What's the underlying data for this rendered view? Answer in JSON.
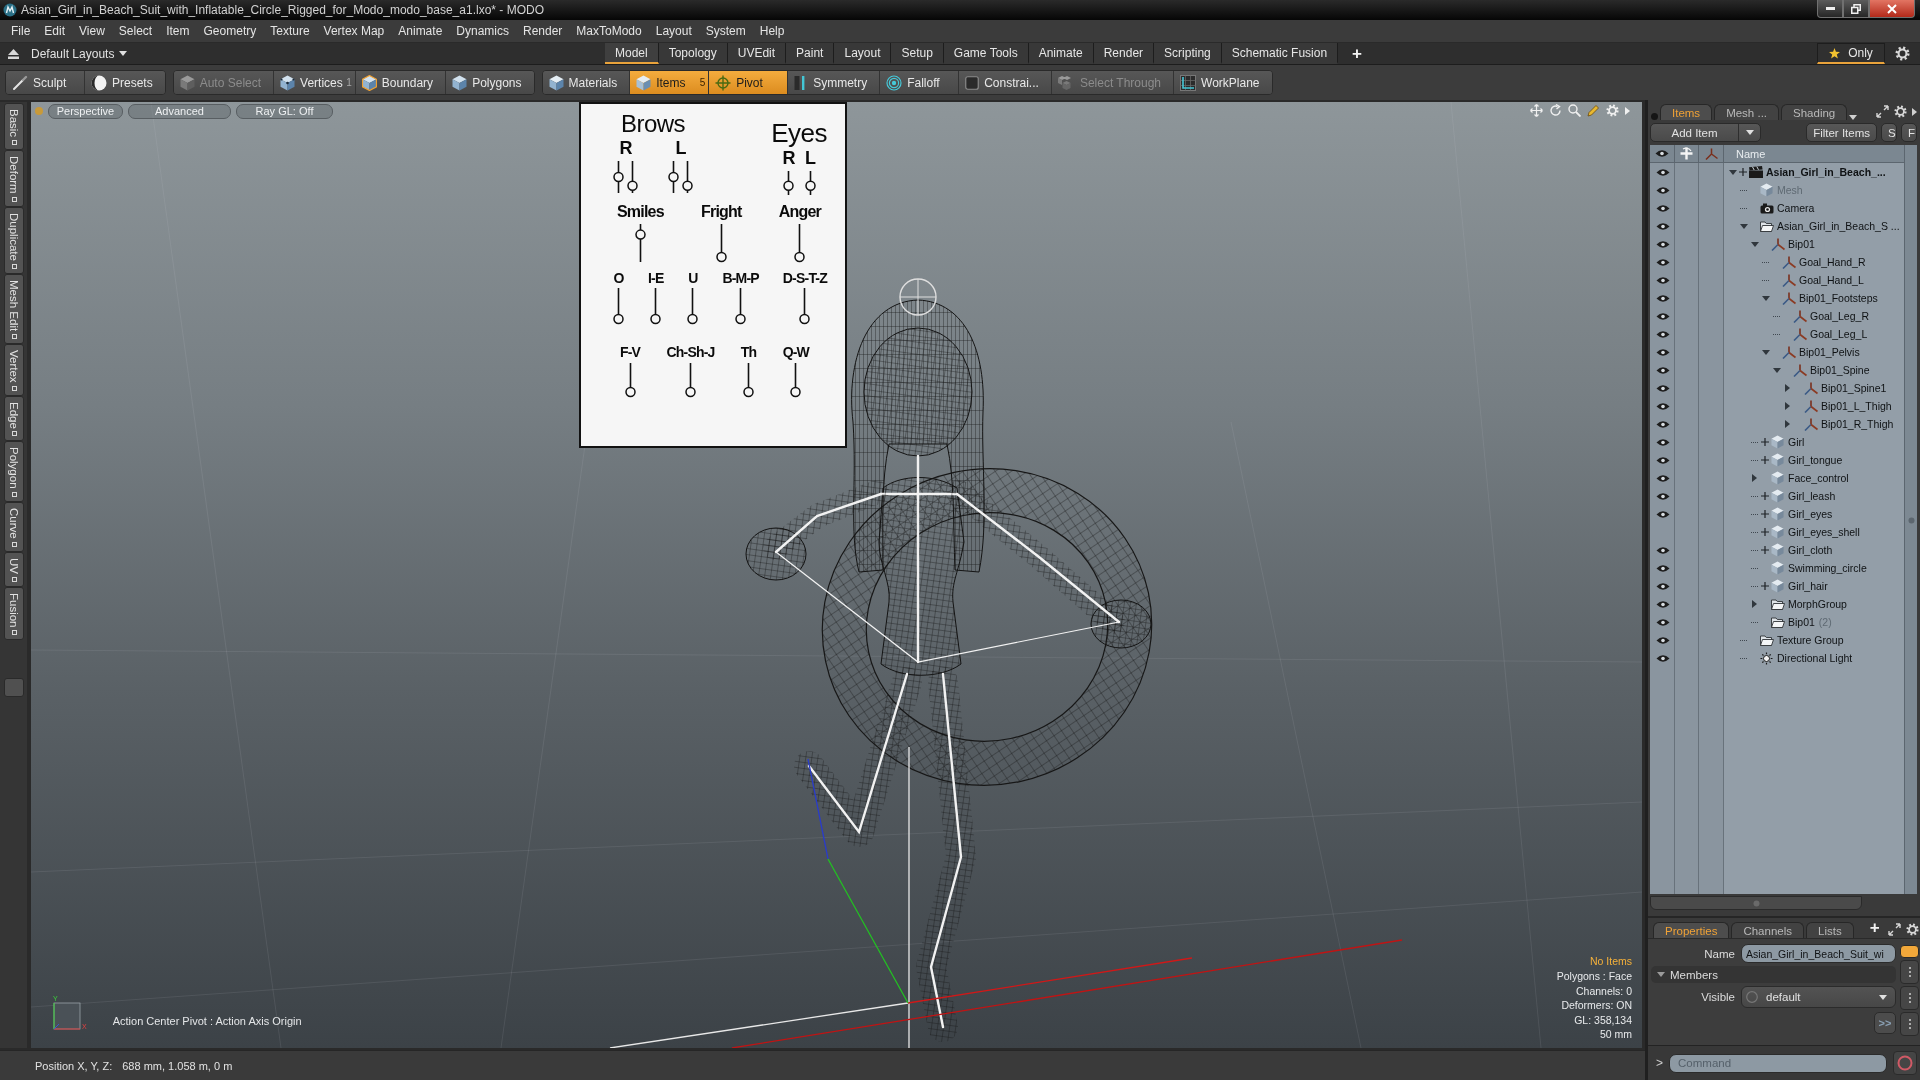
{
  "window": {
    "title": "Asian_Girl_in_Beach_Suit_with_Inflatable_Circle_Rigged_for_Modo_modo_base_a1.lxo* - MODO"
  },
  "menu": [
    "File",
    "Edit",
    "View",
    "Select",
    "Item",
    "Geometry",
    "Texture",
    "Vertex Map",
    "Animate",
    "Dynamics",
    "Render",
    "MaxToModo",
    "Layout",
    "System",
    "Help"
  ],
  "layout_bar": {
    "layouts": "Default Layouts",
    "tabs": [
      {
        "label": "Model",
        "selected": true
      },
      {
        "label": "Topology",
        "selected": false
      },
      {
        "label": "UVEdit",
        "selected": false
      },
      {
        "label": "Paint",
        "selected": false
      },
      {
        "label": "Layout",
        "selected": false
      },
      {
        "label": "Setup",
        "selected": false
      },
      {
        "label": "Game Tools",
        "selected": false
      },
      {
        "label": "Animate",
        "selected": false
      },
      {
        "label": "Render",
        "selected": false
      },
      {
        "label": "Scripting",
        "selected": false
      },
      {
        "label": "Schematic Fusion",
        "selected": false
      }
    ],
    "add": "+",
    "filter": {
      "label": "Only",
      "selected": true
    }
  },
  "toolbar": {
    "groups": [
      {
        "buttons": [
          {
            "label": "Sculpt",
            "kind": "brush",
            "selected": false,
            "disabled": false
          },
          {
            "label": "Presets",
            "kind": "sphere",
            "selected": false,
            "disabled": false
          }
        ]
      },
      {
        "buttons": [
          {
            "label": "Auto Select",
            "kind": "cube",
            "selected": false,
            "disabled": true
          },
          {
            "label": "Vertices",
            "kind": "vertices",
            "badge": "1",
            "selected": false,
            "disabled": false
          },
          {
            "label": "Boundary",
            "kind": "edges",
            "selected": false,
            "disabled": false
          },
          {
            "label": "Polygons",
            "kind": "polygons",
            "selected": false,
            "disabled": false
          }
        ]
      },
      {
        "buttons": [
          {
            "label": "Materials",
            "kind": "materials",
            "selected": false,
            "disabled": false
          },
          {
            "label": "Items",
            "kind": "items",
            "badge": "5",
            "selected": true,
            "disabled": false
          },
          {
            "label": "Pivot",
            "kind": "pivot",
            "selected": true,
            "disabled": false
          },
          {
            "label": "Symmetry",
            "kind": "symmetry",
            "selected": false,
            "disabled": false
          },
          {
            "label": "Falloff",
            "kind": "falloff",
            "selected": false,
            "disabled": false
          },
          {
            "label": "Constrai...",
            "kind": "constraint",
            "selected": false,
            "disabled": false
          },
          {
            "label": "Select Through",
            "kind": "select_through",
            "selected": false,
            "disabled": true
          },
          {
            "label": "WorkPlane",
            "kind": "workplane",
            "selected": false,
            "disabled": false
          }
        ]
      }
    ]
  },
  "left_strip": {
    "tabs": [
      "Basic",
      "Deform",
      "Duplicate",
      "Mesh Edit",
      "Vertex",
      "Edge",
      "Polygon",
      "Curve",
      "UV",
      "Fusion"
    ]
  },
  "viewport": {
    "view_buttons": [
      "Perspective",
      "Advanced",
      "Ray GL: Off"
    ],
    "face_board": {
      "groups": [
        {
          "title": "Brows",
          "channels": [
            {
              "label": "R",
              "sliders": [
                {
                  "level": 0.5
                },
                {
                  "level": 0.1
                }
              ]
            },
            {
              "label": "L",
              "sliders": [
                {
                  "level": 0.5
                },
                {
                  "level": 0.1
                }
              ]
            }
          ]
        },
        {
          "title": "Eyes",
          "channels": [
            {
              "label": "R",
              "sliders": [
                {
                  "level": 0.3
                }
              ]
            },
            {
              "label": "L",
              "sliders": [
                {
                  "level": 0.3
                }
              ]
            }
          ]
        }
      ],
      "lines": [
        {
          "controls": [
            {
              "label": "Smiles",
              "sliders": [
                {
                  "level": 0.8
                }
              ]
            },
            {
              "label": "Fright",
              "sliders": [
                {
                  "level": 0
                }
              ]
            },
            {
              "label": "Anger",
              "sliders": [
                {
                  "level": 0
                }
              ]
            }
          ]
        },
        {
          "controls": [
            {
              "label": "O",
              "sliders": [
                {
                  "level": 0
                }
              ]
            },
            {
              "label": "I-E",
              "sliders": [
                {
                  "level": 0
                }
              ]
            },
            {
              "label": "U",
              "sliders": [
                {
                  "level": 0
                }
              ]
            },
            {
              "label": "B-M-P",
              "sliders": [
                {
                  "level": 0
                }
              ]
            },
            {
              "label": "D-S-T-Z",
              "sliders": [
                {
                  "level": 0
                }
              ]
            }
          ]
        },
        {
          "controls": [
            {
              "label": "F-V",
              "sliders": [
                {
                  "level": 0
                }
              ]
            },
            {
              "label": "Ch-Sh-J",
              "sliders": [
                {
                  "level": 0
                }
              ]
            },
            {
              "label": "Th",
              "sliders": [
                {
                  "level": 0
                }
              ]
            },
            {
              "label": "Q-W",
              "sliders": [
                {
                  "level": 0
                }
              ]
            }
          ]
        }
      ]
    },
    "axis_gizmo": {
      "labels": [
        "Y",
        "X"
      ]
    },
    "action_center": "Action Center Pivot : Action Axis Origin",
    "info": [
      {
        "text": "No Items",
        "highlight": true
      },
      {
        "text": "Polygons : Face",
        "highlight": false
      },
      {
        "text": "Channels: 0",
        "highlight": false
      },
      {
        "text": "Deformers: ON",
        "highlight": false
      },
      {
        "text": "GL: 358,134",
        "highlight": false
      },
      {
        "text": "50 mm",
        "highlight": false
      }
    ]
  },
  "status_bar": {
    "label": "Position X, Y, Z:",
    "value": "688 mm, 1.058 m, 0 m"
  },
  "items_panel": {
    "tabs": [
      {
        "label": "Items",
        "selected": true
      },
      {
        "label": "Mesh ...",
        "selected": false
      },
      {
        "label": "Shading",
        "selected": false
      }
    ],
    "add_item": "Add Item",
    "filter": "Filter Items",
    "toggles": [
      "S",
      "F"
    ],
    "column": "Name",
    "tree": [
      {
        "name": "Asian_Girl_in_Beach_...",
        "kind": "scene",
        "visible": true,
        "plus": true,
        "expanded": true,
        "dimmed": false,
        "children": [
          {
            "name": "Mesh",
            "kind": "mesh",
            "visible": true,
            "plus": false,
            "dimmed": true
          },
          {
            "name": "Camera",
            "kind": "camera",
            "visible": true,
            "plus": false,
            "dimmed": false
          },
          {
            "name": "Asian_Girl_in_Beach_S ...",
            "kind": "group",
            "visible": true,
            "plus": false,
            "expanded": true,
            "dimmed": false,
            "children": [
              {
                "name": "Bip01",
                "kind": "locator",
                "visible": true,
                "plus": false,
                "expanded": true,
                "dimmed": false,
                "children": [
                  {
                    "name": "Goal_Hand_R",
                    "kind": "locator",
                    "visible": true,
                    "plus": false,
                    "dimmed": false
                  },
                  {
                    "name": "Goal_Hand_L",
                    "kind": "locator",
                    "visible": true,
                    "plus": false,
                    "dimmed": false
                  },
                  {
                    "name": "Bip01_Footsteps",
                    "kind": "locator",
                    "visible": true,
                    "plus": false,
                    "expanded": true,
                    "dimmed": false,
                    "children": [
                      {
                        "name": "Goal_Leg_R",
                        "kind": "locator",
                        "visible": true,
                        "plus": false,
                        "dimmed": false
                      },
                      {
                        "name": "Goal_Leg_L",
                        "kind": "locator",
                        "visible": true,
                        "plus": false,
                        "dimmed": false
                      }
                    ]
                  },
                  {
                    "name": "Bip01_Pelvis",
                    "kind": "locator",
                    "visible": true,
                    "plus": false,
                    "expanded": true,
                    "dimmed": false,
                    "children": [
                      {
                        "name": "Bip01_Spine",
                        "kind": "locator",
                        "visible": true,
                        "plus": false,
                        "expanded": true,
                        "dimmed": false,
                        "children": [
                          {
                            "name": "Bip01_Spine1",
                            "kind": "locator",
                            "visible": true,
                            "plus": false,
                            "expanded": false,
                            "dimmed": false
                          },
                          {
                            "name": "Bip01_L_Thigh",
                            "kind": "locator",
                            "visible": true,
                            "plus": false,
                            "expanded": false,
                            "dimmed": false
                          },
                          {
                            "name": "Bip01_R_Thigh",
                            "kind": "locator",
                            "visible": true,
                            "plus": false,
                            "expanded": false,
                            "dimmed": false
                          }
                        ]
                      }
                    ]
                  }
                ]
              },
              {
                "name": "Girl",
                "kind": "mesh",
                "visible": true,
                "plus": true,
                "dimmed": false
              },
              {
                "name": "Girl_tongue",
                "kind": "mesh",
                "visible": true,
                "plus": true,
                "dimmed": false
              },
              {
                "name": "Face_control",
                "kind": "mesh",
                "visible": true,
                "plus": false,
                "expanded": false,
                "dimmed": false
              },
              {
                "name": "Girl_leash",
                "kind": "mesh",
                "visible": true,
                "plus": true,
                "dimmed": false
              },
              {
                "name": "Girl_eyes",
                "kind": "mesh",
                "visible": true,
                "plus": true,
                "dimmed": false
              },
              {
                "name": "Girl_eyes_shell",
                "kind": "mesh",
                "visible": false,
                "plus": true,
                "dimmed": false
              },
              {
                "name": "Girl_cloth",
                "kind": "mesh",
                "visible": true,
                "plus": true,
                "dimmed": false
              },
              {
                "name": "Swimming_circle",
                "kind": "mesh",
                "visible": true,
                "plus": false,
                "dimmed": false
              },
              {
                "name": "Girl_hair",
                "kind": "mesh",
                "visible": true,
                "plus": true,
                "dimmed": false
              },
              {
                "name": "MorphGroup",
                "kind": "group",
                "visible": true,
                "plus": false,
                "expanded": false,
                "dimmed": false
              },
              {
                "name": "Bip01",
                "count": "(2)",
                "kind": "group",
                "visible": true,
                "plus": false,
                "dimmed": false
              }
            ]
          },
          {
            "name": "Texture Group",
            "kind": "group",
            "visible": true,
            "plus": false,
            "dimmed": false
          },
          {
            "name": "Directional Light",
            "kind": "light",
            "visible": true,
            "plus": false,
            "dimmed": false
          }
        ]
      }
    ]
  },
  "properties_panel": {
    "tabs": [
      {
        "label": "Properties",
        "selected": true
      },
      {
        "label": "Channels",
        "selected": false
      },
      {
        "label": "Lists",
        "selected": false
      }
    ],
    "add": "+",
    "name_label": "Name",
    "name_value": "Asian_Girl_in_Beach_Suit_wi",
    "section": {
      "label": "Members",
      "expanded": true
    },
    "visible_label": "Visible",
    "visible_value": "default",
    "more": ">>",
    "side_tabs": [
      {
        "selected": true
      },
      {
        "selected": false
      },
      {
        "selected": false
      },
      {
        "selected": false
      }
    ]
  },
  "command": {
    "prompt": ">",
    "placeholder": "Command"
  }
}
